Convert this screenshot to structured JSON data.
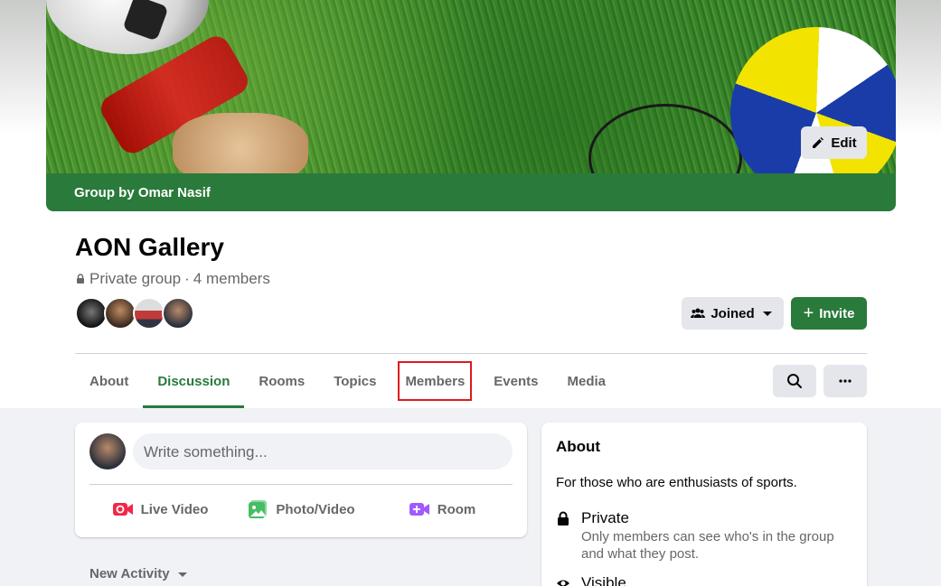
{
  "cover": {
    "edit_label": "Edit",
    "group_by": "Group by Omar Nasif"
  },
  "group": {
    "name": "AON Gallery",
    "privacy": "Private group",
    "separator": "·",
    "members_count": "4 members"
  },
  "actions": {
    "joined_label": "Joined",
    "invite_label": "Invite"
  },
  "tabs": [
    {
      "label": "About",
      "active": false
    },
    {
      "label": "Discussion",
      "active": true
    },
    {
      "label": "Rooms",
      "active": false
    },
    {
      "label": "Topics",
      "active": false
    },
    {
      "label": "Members",
      "active": false,
      "highlighted": true
    },
    {
      "label": "Events",
      "active": false
    },
    {
      "label": "Media",
      "active": false
    }
  ],
  "composer": {
    "placeholder": "Write something...",
    "live_video": "Live Video",
    "photo_video": "Photo/Video",
    "room": "Room"
  },
  "feed": {
    "sort_label": "New Activity"
  },
  "about": {
    "title": "About",
    "description": "For those who are enthusiasts of sports.",
    "private_label": "Private",
    "private_desc": "Only members can see who's in the group and what they post.",
    "visible_label": "Visible"
  },
  "colors": {
    "brand_green": "#2a7a3b",
    "highlight_red": "#e0191f",
    "live_red": "#f02849",
    "photo_green": "#45bd62",
    "room_purple": "#a259ff"
  }
}
